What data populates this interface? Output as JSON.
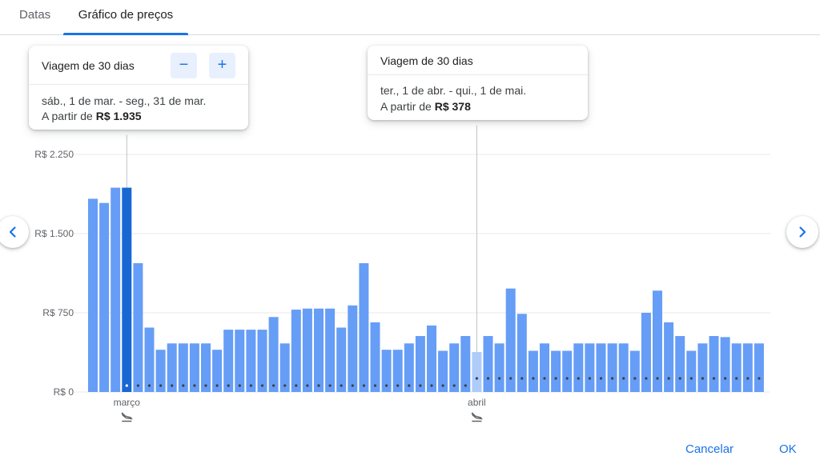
{
  "tabs": {
    "dates": "Datas",
    "chart": "Gráfico de preços"
  },
  "cards": [
    {
      "title": "Viagem de 30 dias",
      "range": "sáb., 1 de mar. - seg., 31 de mar.",
      "price_prefix": "A partir de",
      "price": "R$ 1.935"
    },
    {
      "title": "Viagem de 30 dias",
      "range": "ter., 1 de abr. - qui., 1 de mai.",
      "price_prefix": "A partir de",
      "price": "R$ 378"
    }
  ],
  "stepper": {
    "minus": "−",
    "plus": "+"
  },
  "footer": {
    "cancel": "Cancelar",
    "ok": "OK"
  },
  "colors": {
    "bar": "#669df6",
    "selected": "#1967d2",
    "hover": "#aecbfa",
    "grid": "#e8eaed",
    "dot": "#3c4043",
    "accent": "#1a73e8"
  },
  "chart_data": {
    "type": "bar",
    "y_ticks": [
      "R$ 0",
      "R$ 750",
      "R$ 1.500",
      "R$ 2.250"
    ],
    "y_tick_values": [
      0,
      750,
      1500,
      2250
    ],
    "ylim": [
      0,
      2250
    ],
    "x_labels": [
      {
        "label": "março",
        "index": 3
      },
      {
        "label": "abril",
        "index": 34
      }
    ],
    "selected_index": 3,
    "hover_index": 34,
    "dotted_from_index": 4,
    "values": [
      1830,
      1790,
      1935,
      1935,
      1220,
      610,
      400,
      460,
      460,
      460,
      460,
      400,
      590,
      590,
      590,
      590,
      710,
      460,
      780,
      790,
      790,
      790,
      610,
      820,
      1220,
      660,
      400,
      400,
      460,
      530,
      630,
      390,
      460,
      530,
      378,
      530,
      460,
      980,
      740,
      390,
      460,
      390,
      390,
      460,
      460,
      460,
      460,
      460,
      390,
      750,
      960,
      660,
      530,
      390,
      460,
      530,
      520,
      460,
      460,
      460
    ],
    "grid": true
  }
}
